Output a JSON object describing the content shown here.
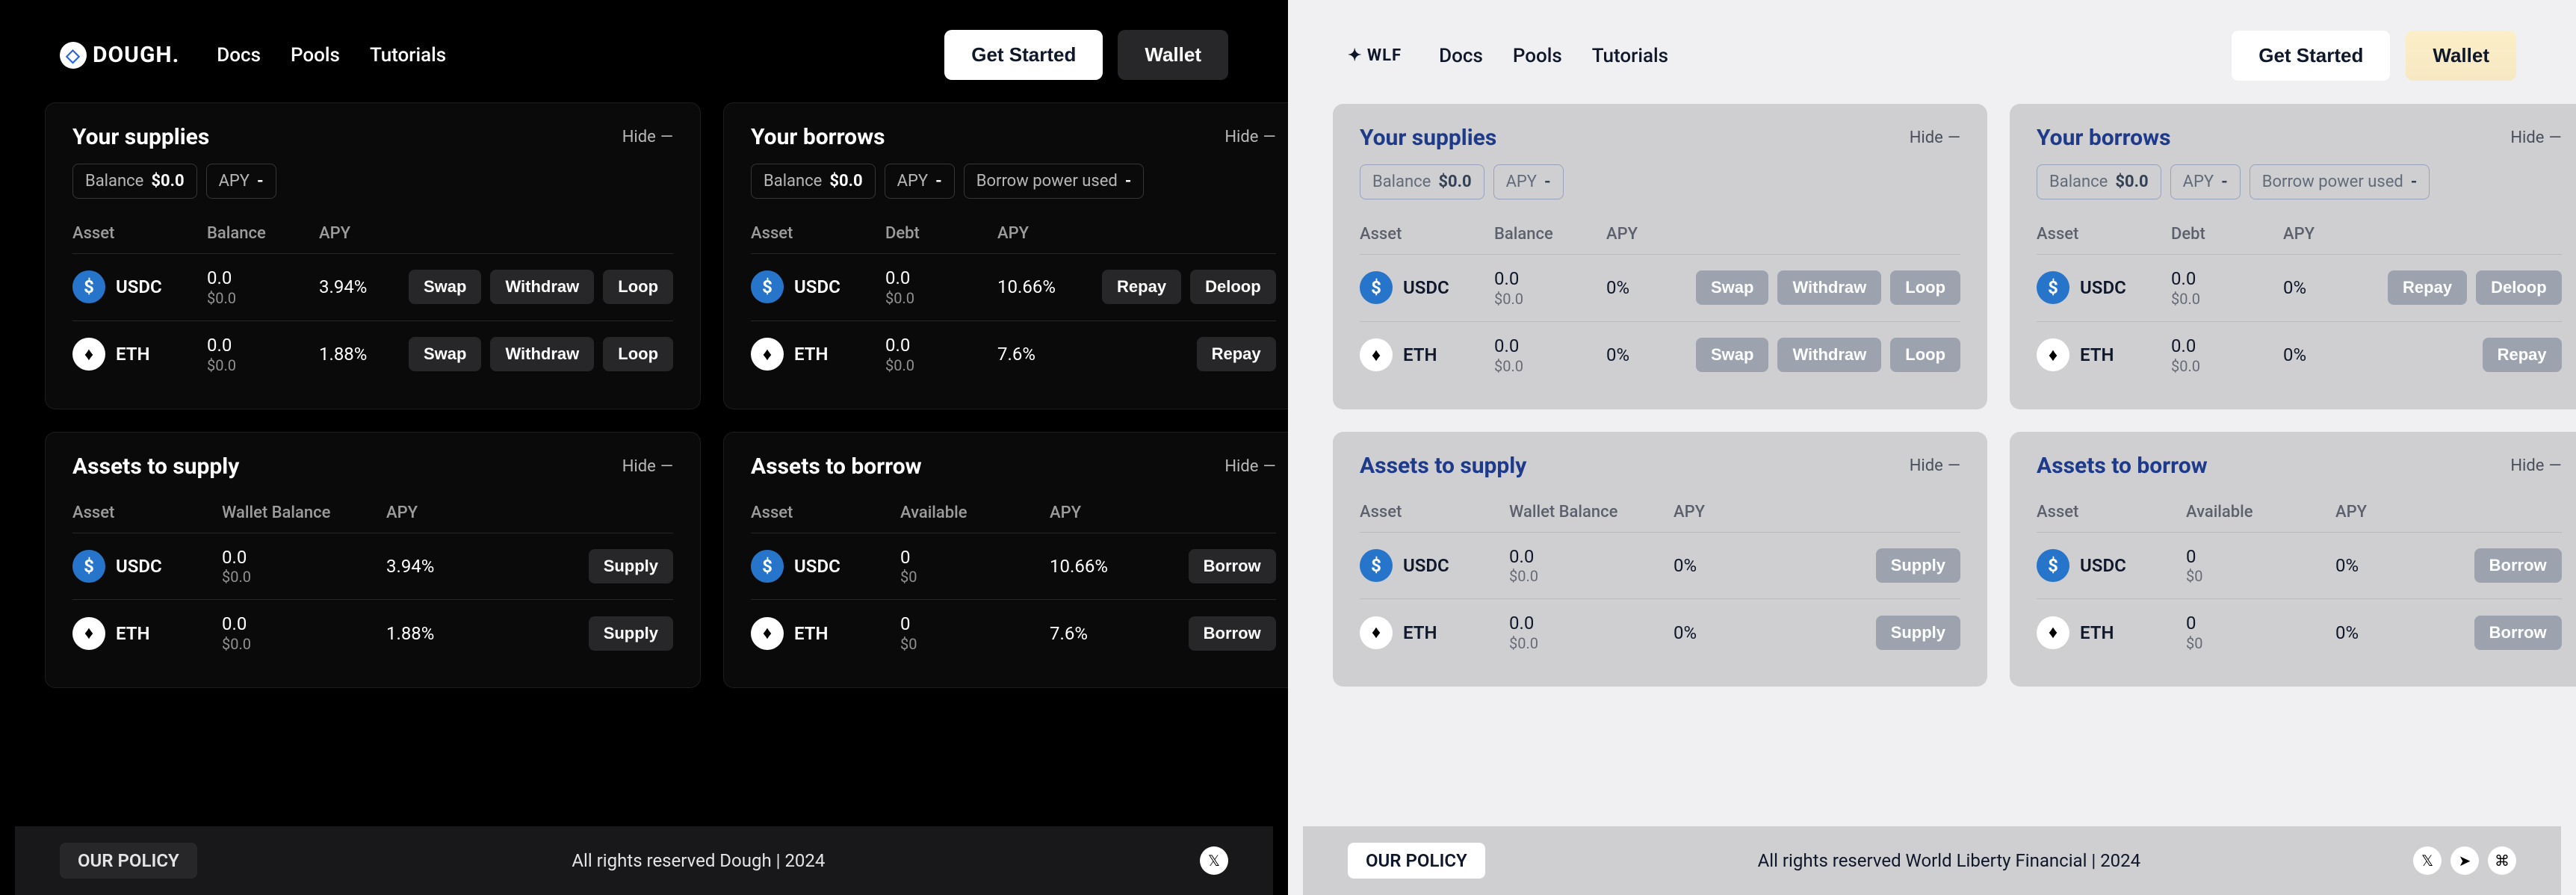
{
  "nav": {
    "docs": "Docs",
    "pools": "Pools",
    "tutorials": "Tutorials"
  },
  "buttons": {
    "getStarted": "Get Started",
    "wallet": "Wallet"
  },
  "chips": {
    "balanceLabel": "Balance",
    "balanceValue": "$0.0",
    "apyLabel": "APY",
    "apyValue": "-",
    "borrowPowerLabel": "Borrow power used",
    "borrowPowerValue": "-"
  },
  "headings": {
    "yourSupplies": "Your supplies",
    "yourBorrows": "Your borrows",
    "assetsToSupply": "Assets to supply",
    "assetsToBorrow": "Assets to borrow",
    "hide": "Hide"
  },
  "headers": {
    "asset": "Asset",
    "balance": "Balance",
    "apy": "APY",
    "debt": "Debt",
    "walletBalance": "Wallet Balance",
    "available": "Available"
  },
  "actions": {
    "swap": "Swap",
    "withdraw": "Withdraw",
    "loop": "Loop",
    "repay": "Repay",
    "deloop": "Deloop",
    "supply": "Supply",
    "borrow": "Borrow"
  },
  "footer": {
    "policy": "OUR POLICY"
  },
  "tokens": {
    "usdc": "USDC",
    "eth": "ETH"
  },
  "left": {
    "logo": "DOUGH.",
    "supplies": {
      "rows": [
        {
          "token": "usdc",
          "name": "USDC",
          "amount": "0.0",
          "sub": "$0.0",
          "apy": "3.94%"
        },
        {
          "token": "eth",
          "name": "ETH",
          "amount": "0.0",
          "sub": "$0.0",
          "apy": "1.88%"
        }
      ]
    },
    "borrows": {
      "rows": [
        {
          "token": "usdc",
          "name": "USDC",
          "amount": "0.0",
          "sub": "$0.0",
          "apy": "10.66%",
          "deloop": true
        },
        {
          "token": "eth",
          "name": "ETH",
          "amount": "0.0",
          "sub": "$0.0",
          "apy": "7.6%",
          "deloop": false
        }
      ]
    },
    "toSupply": {
      "rows": [
        {
          "token": "usdc",
          "name": "USDC",
          "amount": "0.0",
          "sub": "$0.0",
          "apy": "3.94%"
        },
        {
          "token": "eth",
          "name": "ETH",
          "amount": "0.0",
          "sub": "$0.0",
          "apy": "1.88%"
        }
      ]
    },
    "toBorrow": {
      "rows": [
        {
          "token": "usdc",
          "name": "USDC",
          "amount": "0",
          "sub": "$0",
          "apy": "10.66%"
        },
        {
          "token": "eth",
          "name": "ETH",
          "amount": "0",
          "sub": "$0",
          "apy": "7.6%"
        }
      ]
    },
    "copyright": "All rights reserved Dough | 2024"
  },
  "right": {
    "logo": "WLF",
    "supplies": {
      "rows": [
        {
          "token": "usdc",
          "name": "USDC",
          "amount": "0.0",
          "sub": "$0.0",
          "apy": "0%"
        },
        {
          "token": "eth",
          "name": "ETH",
          "amount": "0.0",
          "sub": "$0.0",
          "apy": "0%"
        }
      ]
    },
    "borrows": {
      "rows": [
        {
          "token": "usdc",
          "name": "USDC",
          "amount": "0.0",
          "sub": "$0.0",
          "apy": "0%",
          "deloop": true
        },
        {
          "token": "eth",
          "name": "ETH",
          "amount": "0.0",
          "sub": "$0.0",
          "apy": "0%",
          "deloop": false
        }
      ]
    },
    "toSupply": {
      "rows": [
        {
          "token": "usdc",
          "name": "USDC",
          "amount": "0.0",
          "sub": "$0.0",
          "apy": "0%"
        },
        {
          "token": "eth",
          "name": "ETH",
          "amount": "0.0",
          "sub": "$0.0",
          "apy": "0%"
        }
      ]
    },
    "toBorrow": {
      "rows": [
        {
          "token": "usdc",
          "name": "USDC",
          "amount": "0",
          "sub": "$0",
          "apy": "0%"
        },
        {
          "token": "eth",
          "name": "ETH",
          "amount": "0",
          "sub": "$0",
          "apy": "0%"
        }
      ]
    },
    "copyright": "All rights reserved World Liberty Financial | 2024"
  }
}
